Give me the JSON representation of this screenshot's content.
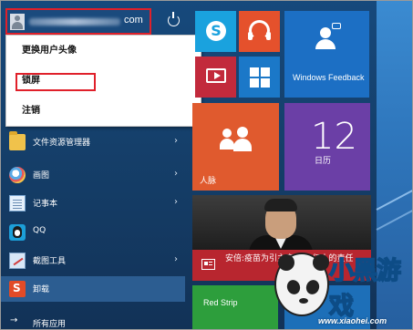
{
  "user": {
    "email_suffix": "com",
    "power_icon": "power-icon"
  },
  "account_menu": {
    "items": [
      {
        "label": "更换用户头像"
      },
      {
        "label": "锁屏"
      },
      {
        "label": "注销"
      }
    ]
  },
  "app_list": [
    {
      "label": "文件资源管理器",
      "icon": "folder-icon",
      "has_submenu": true
    },
    {
      "label": "画图",
      "icon": "paint-icon",
      "has_submenu": true
    },
    {
      "label": "记事本",
      "icon": "notepad-icon",
      "has_submenu": true
    },
    {
      "label": "QQ",
      "icon": "qq-icon",
      "has_submenu": false
    },
    {
      "label": "截图工具",
      "icon": "snipping-tool-icon",
      "has_submenu": true
    },
    {
      "label": "卸载",
      "icon": "uninstall-icon",
      "has_submenu": false
    }
  ],
  "all_apps": {
    "arrow": "→",
    "label": "所有应用"
  },
  "tiles": {
    "skype": {
      "logo": "S",
      "icon": "skype-icon"
    },
    "feedback": {
      "label": "Windows Feedback"
    },
    "people": {
      "label": "人脉"
    },
    "calendar": {
      "number": "12",
      "day": "日历"
    },
    "news": {
      "headline": "安倍:疫苗为引主席对13亿人的责任"
    },
    "red_stripe": {
      "label": "Red Strip"
    }
  },
  "watermark": {
    "title": "小黑游戏",
    "url": "www.xiaohei.com"
  },
  "colors": {
    "highlight_border": "#e0202a",
    "start_bg": "#16497c",
    "tile_orange": "#e05a2e",
    "tile_purple": "#6b3fa6",
    "tile_blue": "#1c6fc4"
  }
}
